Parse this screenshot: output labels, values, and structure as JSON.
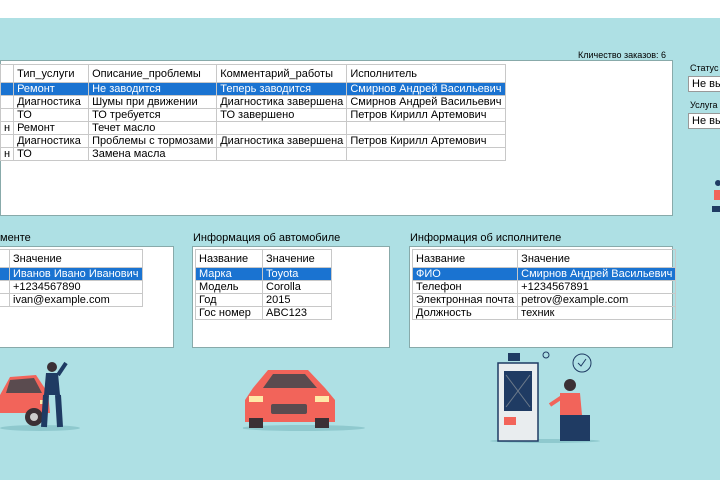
{
  "orders": {
    "count_label": "Кличество заказов: 6",
    "columns": [
      "",
      "Тип_услуги",
      "Описание_проблемы",
      "Комментарий_работы",
      "Исполнитель"
    ],
    "rows": [
      {
        "c0": "",
        "c1": "Ремонт",
        "c2": "Не заводится",
        "c3": "Теперь заводится",
        "c4": "Смирнов Андрей Васильевич"
      },
      {
        "c0": "",
        "c1": "Диагностика",
        "c2": "Шумы при движении",
        "c3": "Диагностика завершена",
        "c4": "Смирнов Андрей Васильевич"
      },
      {
        "c0": "",
        "c1": "ТО",
        "c2": "ТО требуется",
        "c3": "ТО завершено",
        "c4": "Петров Кирилл Артемович"
      },
      {
        "c0": "н",
        "c1": "Ремонт",
        "c2": "Течет масло",
        "c3": "",
        "c4": ""
      },
      {
        "c0": "",
        "c1": "Диагностика",
        "c2": "Проблемы с тормозами",
        "c3": "Диагностика завершена",
        "c4": "Петров Кирилл Артемович"
      },
      {
        "c0": "н",
        "c1": "ТО",
        "c2": "Замена масла",
        "c3": "",
        "c4": ""
      }
    ]
  },
  "filters": {
    "status_label": "Статус",
    "status_value": "Не вы",
    "service_label": "Услуга",
    "service_value": "Не вы"
  },
  "client": {
    "title": "менте",
    "col_value": "Значение",
    "rows": [
      {
        "value": "Иванов Ивано Иванович"
      },
      {
        "value": "+1234567890"
      },
      {
        "value": "ivan@example.com"
      }
    ]
  },
  "car": {
    "title": "Информация об автомобиле",
    "col_name": "Название",
    "col_value": "Значение",
    "rows": [
      {
        "name": "Марка",
        "value": "Toyota"
      },
      {
        "name": "Модель",
        "value": "Corolla"
      },
      {
        "name": "Год",
        "value": "2015"
      },
      {
        "name": "Гос номер",
        "value": "ABC123"
      }
    ]
  },
  "worker": {
    "title": "Информация об исполнителе",
    "col_name": "Название",
    "col_value": "Значение",
    "rows": [
      {
        "name": "ФИО",
        "value": "Смирнов Андрей Васильевич"
      },
      {
        "name": "Телефон",
        "value": "+1234567891"
      },
      {
        "name": "Электронная почта",
        "value": "petrov@example.com"
      },
      {
        "name": "Должность",
        "value": "техник"
      }
    ]
  },
  "colors": {
    "accent": "#1a73d1",
    "background": "#aee0e4",
    "car": "#f2645a"
  }
}
